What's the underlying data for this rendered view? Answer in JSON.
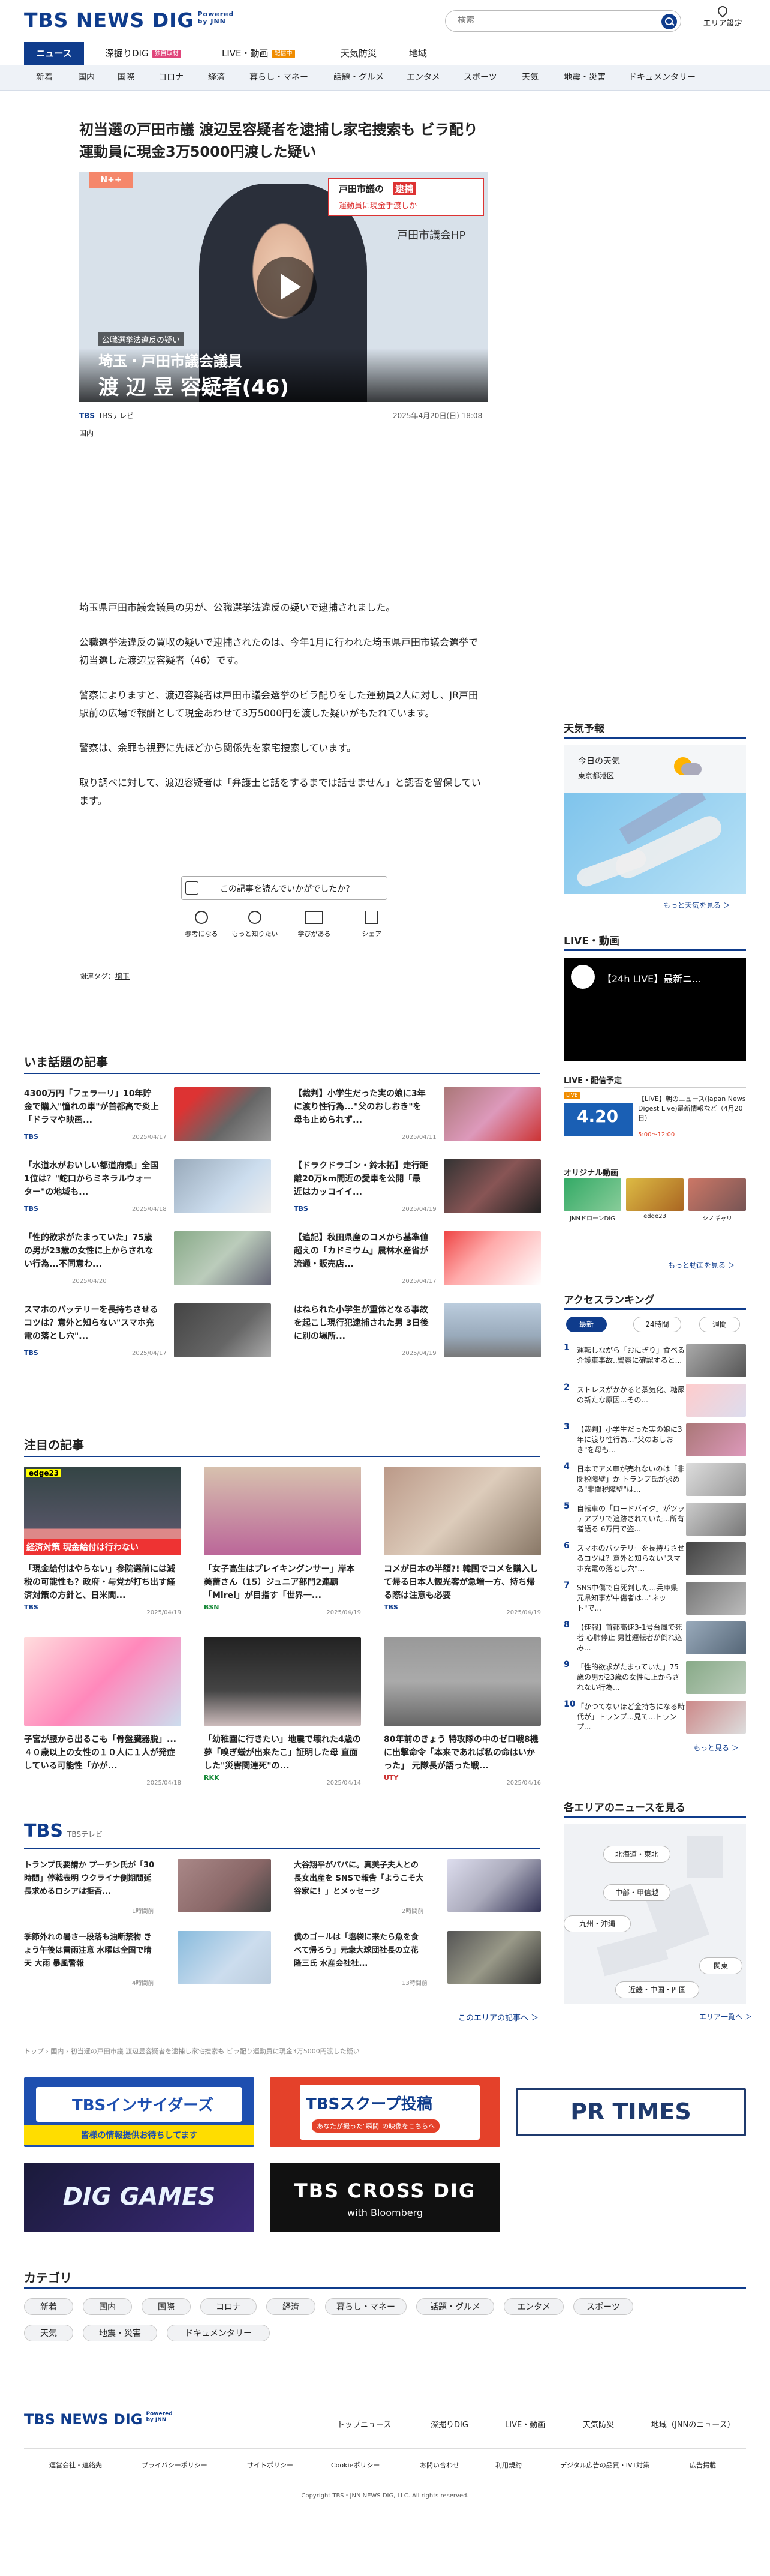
{
  "header": {
    "logo": "TBS NEWS DIG",
    "powered": "Powered by JNN",
    "search_placeholder": "検索",
    "area_label": "エリア設定"
  },
  "nav1": {
    "news": "ニュース",
    "deep": "深掘りDIG",
    "deep_badge": "独自取材",
    "live": "LIVE・動画",
    "live_badge": "配信中",
    "weather": "天気防災",
    "region": "地域"
  },
  "nav2": [
    "新着",
    "国内",
    "国際",
    "コロナ",
    "経済",
    "暮らし・マネー",
    "話題・グルメ",
    "エンタメ",
    "スポーツ",
    "天気",
    "地震・災害",
    "ドキュメンタリー"
  ],
  "article": {
    "title": "初当選の戸田市議 渡辺昱容疑者を逮捕し家宅捜索も ビラ配り運動員に現金3万5000円渡した疑い",
    "new_label": "N++",
    "video_caption1": "公職選挙法違反の疑い",
    "video_caption2": "埼玉・戸田市議会議員",
    "video_caption3": "渡 辺 昱 容疑者(46)",
    "video_corner1": "戸田市議の",
    "video_corner2": "逮捕",
    "video_corner3": "運動員に現金手渡しか",
    "video_corner4": "戸田市議会HP",
    "source": "TBSテレビ",
    "date": "2025年4月20日(日) 18:08",
    "category": "国内",
    "paragraphs": [
      "埼玉県戸田市議会議員の男が、公職選挙法違反の疑いで逮捕されました。",
      "公職選挙法違反の買収の疑いで逮捕されたのは、今年1月に行われた埼玉県戸田市議会選挙で初当選した渡辺昱容疑者（46）です。",
      "警察によりますと、渡辺容疑者は戸田市議会選挙のビラ配りをした運動員2人に対し、JR戸田駅前の広場で報酬として現金あわせて3万5000円を渡した疑いがもたれています。",
      "警察は、余罪も視野に先ほどから関係先を家宅捜索しています。",
      "取り調べに対して、渡辺容疑者は「弁護士と話をするまでは話せません」と認否を留保しています。"
    ],
    "feedback_prompt": "この記事を読んでいかがでしたか？",
    "reactions": [
      "参考になる",
      "もっと知りたい",
      "学びがある",
      "シェア"
    ],
    "tags_label": "関連タグ：",
    "tag": "埼玉"
  },
  "trending": {
    "title": "いま話題の記事",
    "items": [
      {
        "title": "4300万円「フェラーリ」10年貯金で購入\"憧れの車\"が首都高で炎上「ドラマや映画...",
        "source": "TBS",
        "date": "2025/04/17"
      },
      {
        "title": "【裁判】小学生だった実の娘に3年に渡り性行為...\"父のおしおき\"を母も止められず...",
        "source": "",
        "date": "2025/04/11"
      },
      {
        "title": "「水道水がおいしい都道府県」全国1位は？\"蛇口からミネラルウォーター\"の地域も...",
        "source": "TBS",
        "date": "2025/04/18"
      },
      {
        "title": "【ドラクドラゴン・鈴木拓】走行距離20万km間近の愛車を公開「最近はカッコイイ...",
        "source": "TBS",
        "date": "2025/04/19"
      },
      {
        "title": "「性的欲求がたまっていた」75歳の男が23歳の女性に上からされない行為...不同意わ...",
        "source": "",
        "date": "2025/04/20"
      },
      {
        "title": "【追記】秋田県産のコメから基準値超えの「カドミウム」農林水産省が流通・販売店...",
        "source": "",
        "date": "2025/04/17"
      },
      {
        "title": "スマホのバッテリーを長持ちさせるコツは？意外と知らない\"スマホ充電の落とし穴\"...",
        "source": "TBS",
        "date": "2025/04/17"
      },
      {
        "title": "はねられた小学生が重体となる事故を起こし現行犯逮捕された男 3日後に別の場所...",
        "source": "",
        "date": "2025/04/19"
      }
    ]
  },
  "featured": {
    "title": "注目の記事",
    "items": [
      {
        "title": "「現金給付はやらない」参院選前には減税の可能性も？政府・与党が打ち出す経済対策の方針と、日米関...",
        "source": "TBS",
        "date": "2025/04/19",
        "tag": "edge23",
        "thumb_text": "経済対策 現金給付は行わない"
      },
      {
        "title": "「女子高生はプレイキングンサー」岸本美蕾さん（15）ジュニア部門2連覇「Mirei」が目指す「世界一...",
        "source": "BSN",
        "date": "2025/04/19"
      },
      {
        "title": "コメが日本の半額?! 韓国でコメを購入して帰る日本人観光客が急増一方、持ち帰る際は注意も必要",
        "source": "TBS",
        "date": "2025/04/19"
      },
      {
        "title": "子宮が腰から出るこも「骨盤臓器脱」...４０歳以上の女性の１０人に１人が発症している可能性「かが...",
        "source": "",
        "date": "2025/04/18"
      },
      {
        "title": "「幼稚園に行きたい」地震で壊れた4歳の夢「嗅ぎ蟻が出来たこ」証明した母 直面した\"災害関連死\"の...",
        "source": "RKK",
        "date": "2025/04/14"
      },
      {
        "title": "80年前のきょう 特攻隊の中のゼロ戦8機に出撃命令「本来であれば私の命はいかった」 元隊長が語った戦...",
        "source": "UTY",
        "date": "2025/04/16"
      }
    ]
  },
  "tbs_section": {
    "logo": "TBS",
    "sub": "TBSテレビ",
    "items": [
      {
        "title": "トランプ氏要請か プーチン氏が「30時間」停戦表明 ウクライナ側期間延長求めるロシアは拒否...",
        "date": "1時間前"
      },
      {
        "title": "大谷翔平がパパに。真美子夫人との長女出産を SNSで報告「ようこそ大谷家に！」とメッセージ",
        "date": "2時間前"
      },
      {
        "title": "季節外れの暑さ一段落も油断禁物 きょう午後は雷雨注意 水曜は全国で晴天 大雨 暴風警報",
        "date": "4時間前"
      },
      {
        "title": "僕のゴールは「塩袋に来たら魚を食べて帰ろう」元衆大球団社長の立花隆三氏 水産会社社...",
        "date": "13時間前"
      }
    ],
    "more": "このエリアの記事へ ＞"
  },
  "breadcrumb": "トップ › 国内 › 初当選の戸田市議 渡辺昱容疑者を逮捕し家宅捜索も ビラ配り運動員に現金3万5000円渡した疑い",
  "banners": {
    "insider": "TBSインサイダーズ",
    "insider_sub": "皆様の情報提供お待ちしてます",
    "scoop": "TBSスクープ投稿",
    "scoop_sub": "あなたが撮った\"瞬間\"の映像をこちらへ",
    "prtimes": "PR TIMES",
    "diggames": "DIG GAMES",
    "crossdig": "TBS CROSS DIG",
    "crossdig_sub": "with Bloomberg"
  },
  "categories": {
    "title": "カテゴリ",
    "items": [
      "新着",
      "国内",
      "国際",
      "コロナ",
      "経済",
      "暮らし・マネー",
      "話題・グルメ",
      "エンタメ",
      "スポーツ",
      "天気",
      "地震・災害",
      "ドキュメンタリー"
    ]
  },
  "sidebar": {
    "weather_title": "天気予報",
    "weather_today": "今日の天気",
    "weather_place": "東京都港区",
    "weather_more": "もっと天気を見る ＞",
    "live_title": "LIVE・動画",
    "live_video_title": "【24h LIVE】最新ニ...",
    "schedule_title": "LIVE・配信予定",
    "schedule_badge": "LIVE",
    "schedule_text": "【LIVE】朝のニュース(Japan News Digest Live)最新情報など（4月20日）",
    "schedule_time": "5:00～12:00",
    "schedule_date": "4.20",
    "original_title": "オリジナル動画",
    "original": [
      "JNNドローンDIG",
      "edge23",
      "シノギャリ"
    ],
    "original_more": "もっと動画を見る ＞",
    "ranking_title": "アクセスランキング",
    "ranking_tabs": [
      "最新",
      "24時間",
      "週間"
    ],
    "ranking": [
      "運転しながら「おにぎり」食べる介護車事故..警察に確認すると...",
      "ストレスがかかると蒸気化、糖尿の新たな原因...その...",
      "【裁判】小学生だった実の娘に3年に渡り性行為...\"父のおしおき\"を母も...",
      "日本でアメ車が売れないのは「非関税障壁」か トランプ氏が求める\"非関税障壁\"は...",
      "自転車の「ロードバイク」がツッテアプリで追跡されていた...所有者語る 6万円で盗...",
      "スマホのバッテリーを長持ちさせるコツは？意外と知らない\"スマホ充電の落とし穴\"...",
      "SNS中傷で自死判した…兵庫県元県知事が中傷者は...\"ネット\"で...",
      "【速報】首都高速3-1号台風で死者 心肺停止 男性運転者が倒れ込み...",
      "「性的欲求がたまっていた」75歳の男が23歳の女性に上からされない行為...",
      "「かつてないほど金持ちになる時代が」トランプ...見て...トランプ..."
    ],
    "ranking_more": "もっと見る ＞",
    "area_title": "各エリアのニュースを見る",
    "areas": [
      "北海道・東北",
      "中部・甲信越",
      "九州・沖縄",
      "関東",
      "近畿・中国・四国"
    ],
    "area_more": "エリア一覧へ ＞"
  },
  "footer": {
    "logo": "TBS NEWS DIG",
    "powered": "Powered by JNN",
    "links": [
      "トップニュース",
      "深掘りDIG",
      "LIVE・動画",
      "天気防災",
      "地域（JNNのニュース）"
    ],
    "small": [
      "運営会社・連絡先",
      "プライバシーポリシー",
      "サイトポリシー",
      "Cookieポリシー",
      "お問い合わせ",
      "利用規約",
      "デジタル広告の品質・IVT対策",
      "広告掲載"
    ],
    "copyright": "Copyright TBS・JNN NEWS DIG, LLC. All rights reserved."
  }
}
